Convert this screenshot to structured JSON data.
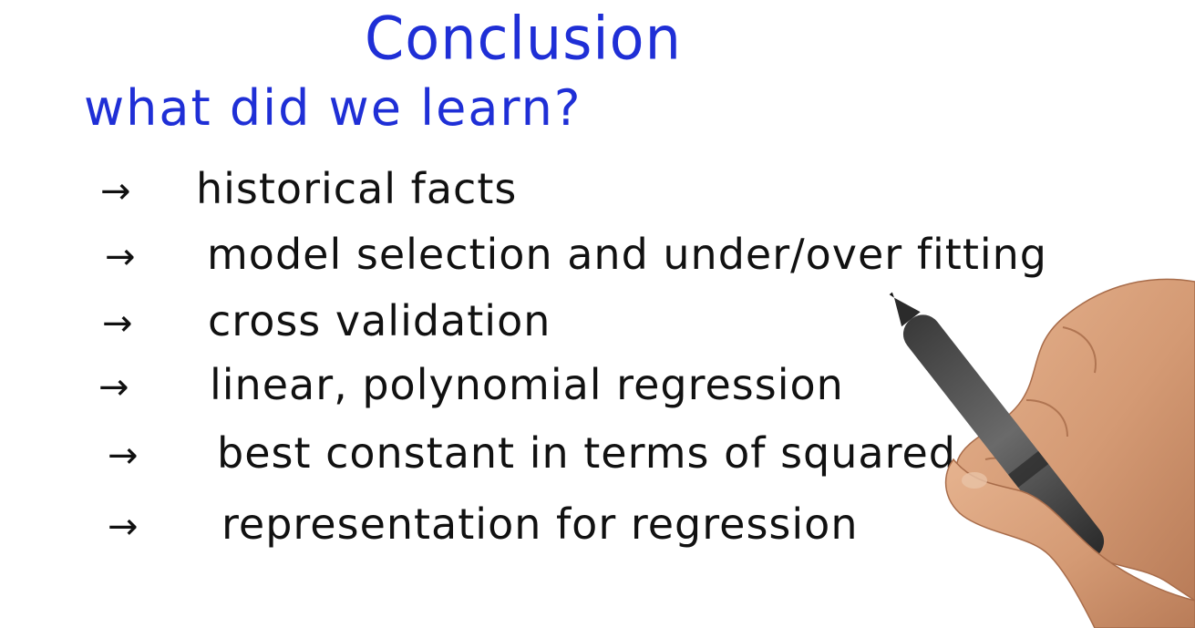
{
  "title": "Conclusion",
  "subtitle": "what did we learn?",
  "bullet_marker": "→",
  "bullets": [
    "historical facts",
    "model selection and under/over fitting",
    "cross validation",
    "linear, polynomial regression",
    "best constant in terms of squared error: mean.",
    "representation for regression"
  ],
  "colors": {
    "title_ink": "#1f2fd6",
    "body_ink": "#111111",
    "background": "#ffffff"
  }
}
